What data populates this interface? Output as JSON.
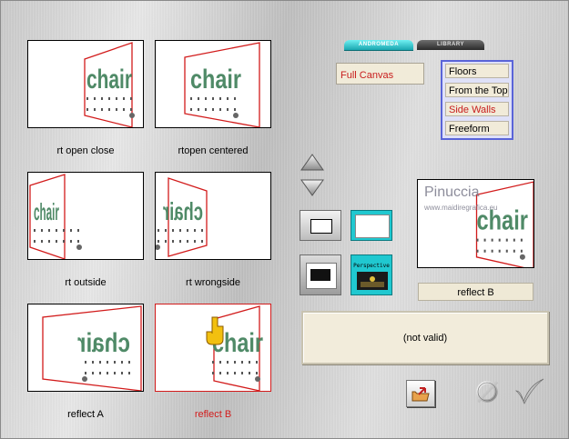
{
  "presets": [
    {
      "label": "rt open close",
      "selected": false
    },
    {
      "label": "rtopen centered",
      "selected": false
    },
    {
      "label": "rt outside",
      "selected": false
    },
    {
      "label": "rt wrongside",
      "selected": false
    },
    {
      "label": "reflect A",
      "selected": false
    },
    {
      "label": "reflect B",
      "selected": true
    }
  ],
  "thumb_text": "chair",
  "tabs": {
    "active": "ANDROMEDA",
    "inactive": "LIBRARY"
  },
  "mode_field": "Full Canvas",
  "options": {
    "items": [
      "Floors",
      "From the Top",
      "Side Walls",
      "Freeform"
    ],
    "selected": "Side Walls"
  },
  "perspective_label": "Perspective",
  "preview": {
    "watermark_title": "Pinuccia",
    "watermark_url": "www.maidiregrafica.eu",
    "name": "reflect B"
  },
  "status_text": "(not valid)",
  "colors": {
    "selected_text": "#c81c1c",
    "accent_tab": "#1aa7b0",
    "options_border": "#5a64d8"
  },
  "icons": [
    "arrow-up-icon",
    "arrow-down-icon",
    "open-folder-icon",
    "cancel-icon",
    "ok-checkmark-icon",
    "hand-pointer-icon"
  ]
}
